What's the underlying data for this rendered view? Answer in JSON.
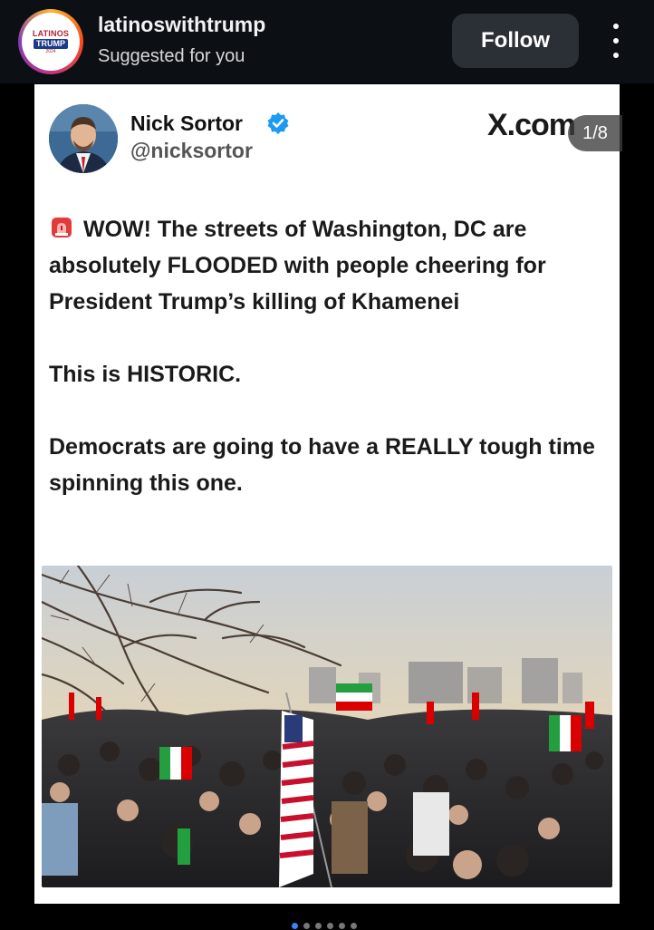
{
  "header": {
    "account_name": "latinoswithtrump",
    "subtitle": "Suggested for you",
    "follow_label": "Follow",
    "avatar_logo": {
      "line1": "LATINOS",
      "line2": "TRUMP",
      "line3": "2024"
    }
  },
  "post": {
    "author_name": "Nick Sortor",
    "author_handle": "@nicksortor",
    "source_label": "X.com",
    "page_indicator": "1/8",
    "paragraphs": [
      "WOW! The streets of Washington, DC are absolutely FLOODED with people cheering for President Trump’s killing of Khamenei",
      "This is HISTORIC.",
      "Democrats are going to have a REALLY tough time spinning this one."
    ],
    "icons": {
      "verified": "verified-check-icon",
      "siren": "siren-emoji-icon",
      "more": "more-vertical-icon"
    }
  },
  "carousel": {
    "total": 6,
    "active_index": 0
  },
  "colors": {
    "header_bg": "#0c0f14",
    "follow_bg": "#2b2f36",
    "verified_blue": "#1d9bf0",
    "active_dot": "#3b82f6"
  }
}
